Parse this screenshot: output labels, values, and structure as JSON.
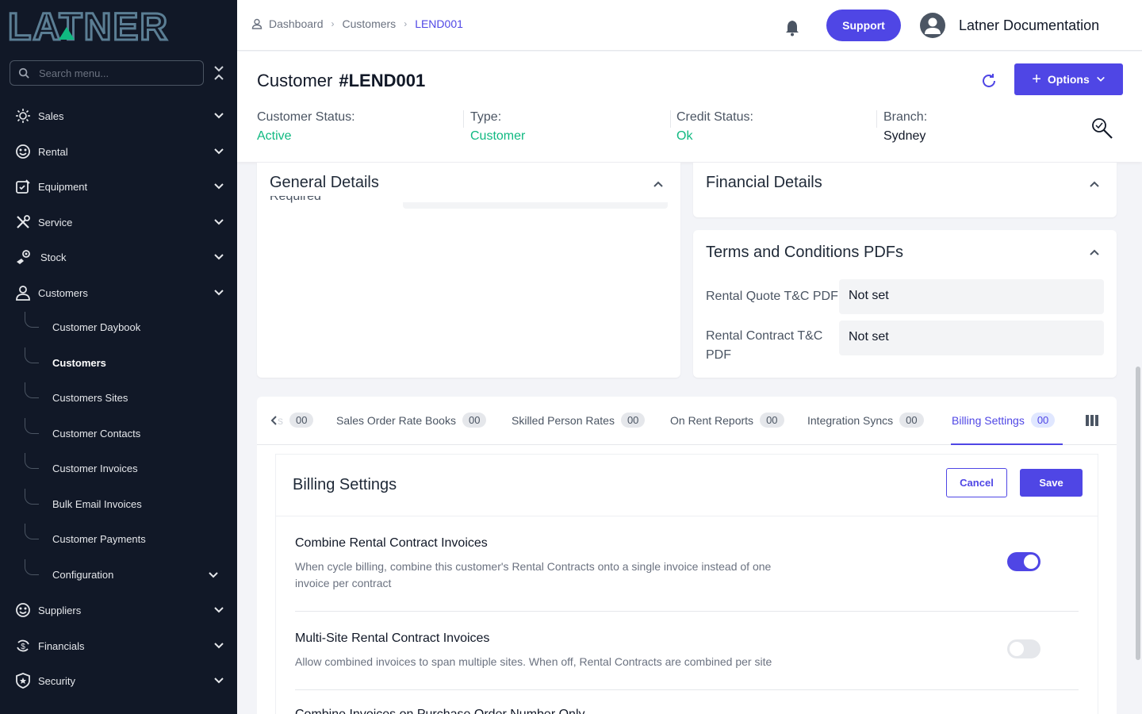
{
  "sidebar": {
    "logo_text": "LATNER",
    "search_placeholder": "Search menu...",
    "items": [
      {
        "label": "Sales",
        "icon": "sales-icon"
      },
      {
        "label": "Rental",
        "icon": "rental-icon"
      },
      {
        "label": "Equipment",
        "icon": "equipment-icon"
      },
      {
        "label": "Service",
        "icon": "service-icon"
      },
      {
        "label": "Stock",
        "icon": "stock-icon"
      },
      {
        "label": "Customers",
        "icon": "customers-icon"
      }
    ],
    "sub_items": [
      {
        "label": "Customer Daybook"
      },
      {
        "label": "Customers",
        "active": true
      },
      {
        "label": "Customers Sites"
      },
      {
        "label": "Customer Contacts"
      },
      {
        "label": "Customer Invoices"
      },
      {
        "label": "Bulk Email Invoices"
      },
      {
        "label": "Customer Payments"
      },
      {
        "label": "Configuration"
      }
    ],
    "lower_items": [
      {
        "label": "Suppliers",
        "icon": "suppliers-icon"
      },
      {
        "label": "Financials",
        "icon": "financials-icon"
      },
      {
        "label": "Security",
        "icon": "security-icon"
      }
    ]
  },
  "topbar": {
    "breadcrumb": [
      "Dashboard",
      "Customers",
      "LEND001"
    ],
    "support_label": "Support",
    "user_name": "Latner Documentation"
  },
  "header": {
    "title_prefix": "Customer",
    "title_id": "#LEND001",
    "options_label": "Options",
    "stats": [
      {
        "label": "Customer Status:",
        "value": "Active"
      },
      {
        "label": "Type:",
        "value": "Customer"
      },
      {
        "label": "Credit Status:",
        "value": "Ok"
      },
      {
        "label": "Branch:",
        "value": "Sydney"
      }
    ]
  },
  "general_details": {
    "title": "General Details",
    "partial_label": "Required"
  },
  "financial_details": {
    "title": "Financial Details"
  },
  "terms": {
    "title": "Terms and Conditions PDFs",
    "rows": [
      {
        "label": "Rental Quote T&C PDF",
        "value": "Not set"
      },
      {
        "label": "Rental Contract T&C PDF",
        "value": "Not set"
      }
    ]
  },
  "tabs": {
    "partial_label": "s",
    "partial_count": "00",
    "items": [
      {
        "label": "Sales Order Rate Books",
        "count": "00"
      },
      {
        "label": "Skilled Person Rates",
        "count": "00"
      },
      {
        "label": "On Rent Reports",
        "count": "00"
      },
      {
        "label": "Integration Syncs",
        "count": "00"
      },
      {
        "label": "Billing Settings",
        "count": "00",
        "active": true
      }
    ]
  },
  "billing": {
    "title": "Billing Settings",
    "cancel_label": "Cancel",
    "save_label": "Save",
    "settings": [
      {
        "title": "Combine Rental Contract Invoices",
        "description": "When cycle billing, combine this customer's Rental Contracts onto a single invoice instead of one invoice per contract",
        "enabled": true
      },
      {
        "title": "Multi-Site Rental Contract Invoices",
        "description": "Allow combined invoices to span multiple sites. When off, Rental Contracts are combined per site",
        "enabled": false
      },
      {
        "title": "Combine Invoices on Purchase Order Number Only",
        "description": "",
        "enabled": false
      }
    ]
  },
  "colors": {
    "accent": "#4f46e5",
    "sidebar_bg": "#111827",
    "status_green": "#10b981"
  }
}
